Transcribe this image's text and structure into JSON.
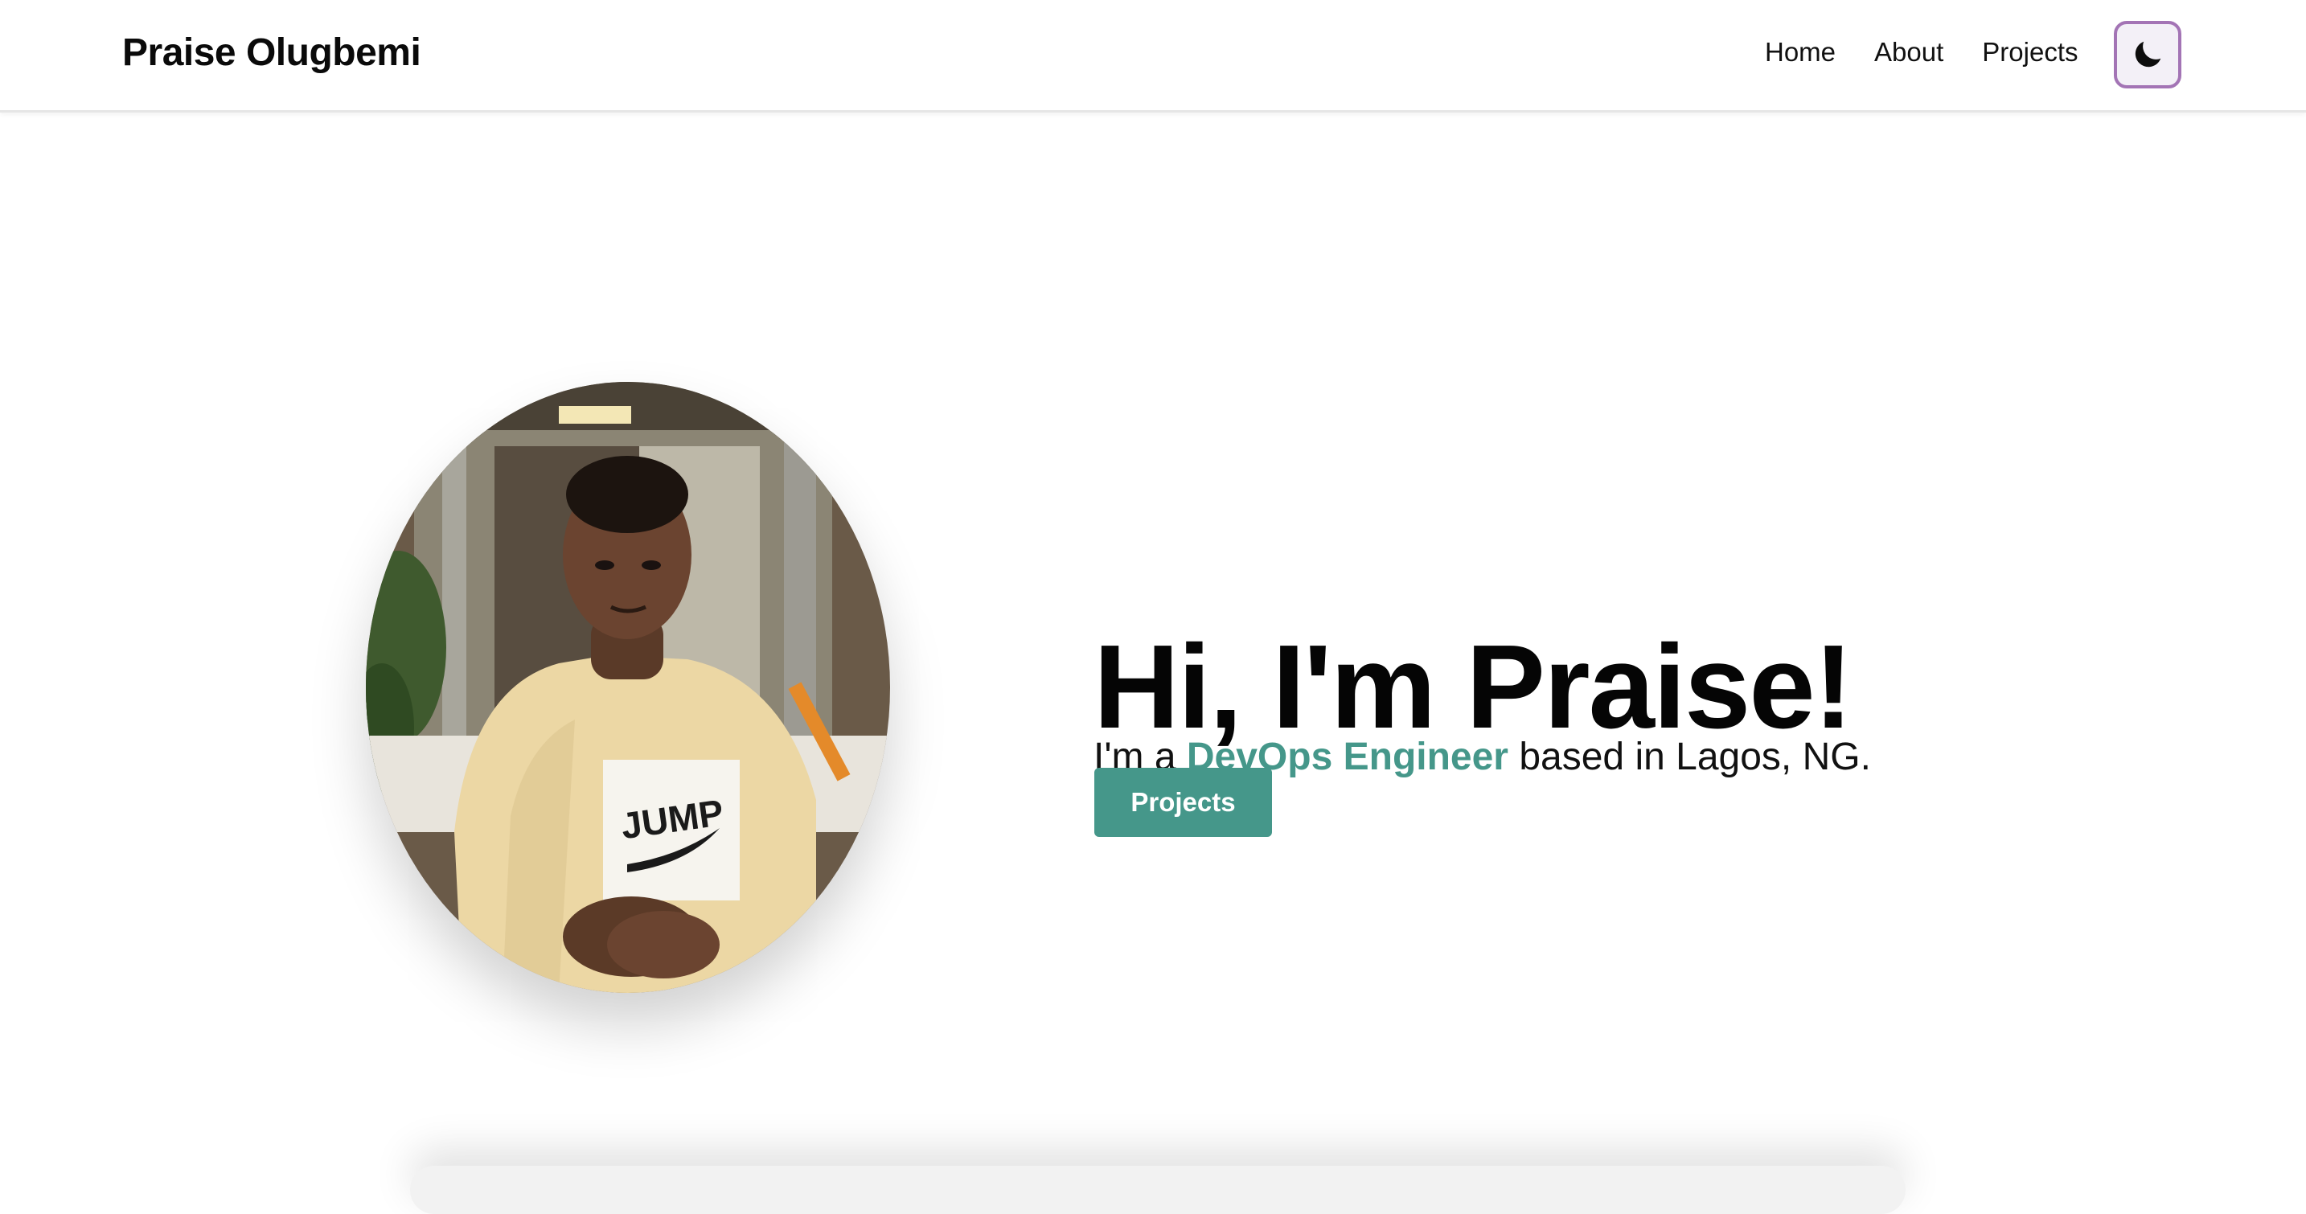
{
  "header": {
    "brand": "Praise Olugbemi",
    "nav": [
      {
        "label": "Home"
      },
      {
        "label": "About"
      },
      {
        "label": "Projects"
      }
    ],
    "theme_toggle_icon": "moon-icon"
  },
  "hero": {
    "title": "Hi, I'm Praise!",
    "subtitle_prefix": "I'm a ",
    "subtitle_highlight": "DevOps Engineer",
    "subtitle_suffix": " based in Lagos, NG.",
    "cta_label": "Projects",
    "portrait_shirt_text": "JUMP"
  },
  "colors": {
    "accent": "#45978a",
    "toggle_border": "#a374b5"
  }
}
